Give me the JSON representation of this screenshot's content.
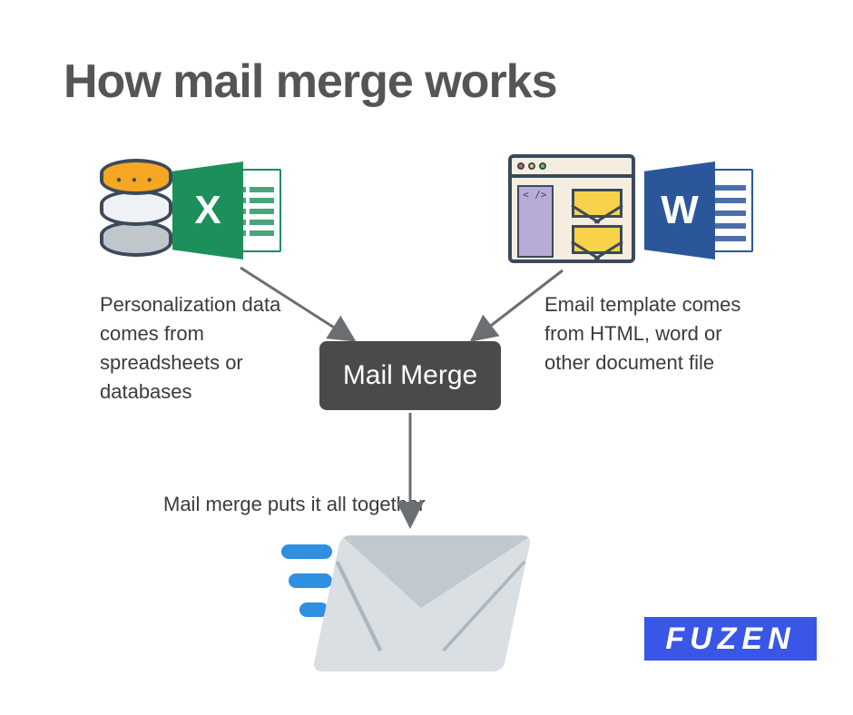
{
  "title": "How mail merge works",
  "left_source": {
    "caption": "Personalization data comes from spreadsheets or databases",
    "db_icon": "database-icon",
    "spreadsheet_icon": "excel-icon",
    "spreadsheet_letter": "X"
  },
  "right_source": {
    "caption": "Email template comes from HTML, word or other document file",
    "html_icon": "html-template-icon",
    "html_code_snippet": "< />",
    "doc_icon": "word-icon",
    "doc_letter": "W"
  },
  "center_box": {
    "label": "Mail Merge"
  },
  "output": {
    "caption": "Mail merge puts it all together",
    "icon": "sent-envelope-icon"
  },
  "brand": {
    "name": "FUZEN",
    "color": "#3a56e6"
  },
  "arrow_color": "#6b6f72"
}
